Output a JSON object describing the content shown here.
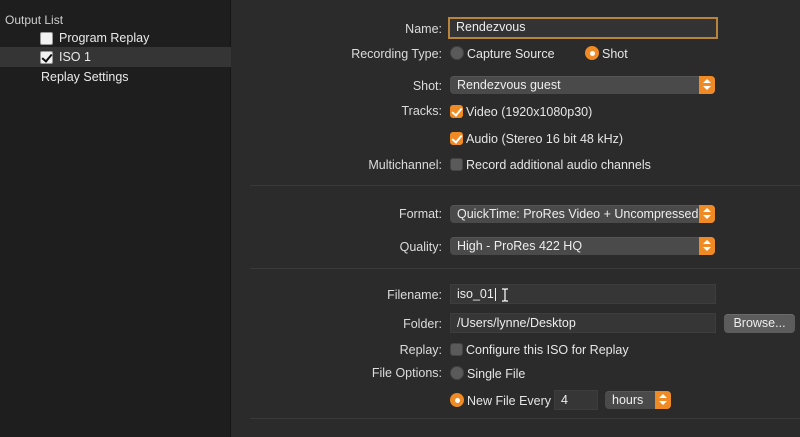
{
  "sidebar": {
    "header": "Output List",
    "items": [
      {
        "label": "Program Replay",
        "checked": false,
        "selected": false
      },
      {
        "label": "ISO 1",
        "checked": true,
        "selected": true
      }
    ],
    "settings_label": "Replay Settings"
  },
  "form": {
    "name_label": "Name:",
    "name_value": "Rendezvous",
    "recording_type_label": "Recording Type:",
    "recording_options": [
      "Capture Source",
      "Shot"
    ],
    "shot_label": "Shot:",
    "shot_value": "Rendezvous guest",
    "tracks_label": "Tracks:",
    "track_video": "Video (1920x1080p30)",
    "track_audio": "Audio (Stereo 16 bit 48 kHz)",
    "multichannel_label": "Multichannel:",
    "multichannel_option": "Record additional audio channels",
    "format_label": "Format:",
    "format_value": "QuickTime: ProRes Video + Uncompressed...",
    "quality_label": "Quality:",
    "quality_value": "High - ProRes 422 HQ",
    "filename_label": "Filename:",
    "filename_value": "iso_01",
    "folder_label": "Folder:",
    "folder_value": "/Users/lynne/Desktop",
    "browse_label": "Browse...",
    "replay_label": "Replay:",
    "replay_option": "Configure this ISO for Replay",
    "file_options_label": "File Options:",
    "single_file_label": "Single File",
    "new_file_label": "New File Every",
    "new_file_count": "4",
    "new_file_unit": "hours"
  },
  "colors": {
    "accent": "#f08a24",
    "focus_ring": "#b8833a",
    "sidebar_bg": "#1e1e1e",
    "main_bg": "#2b2b2b"
  }
}
